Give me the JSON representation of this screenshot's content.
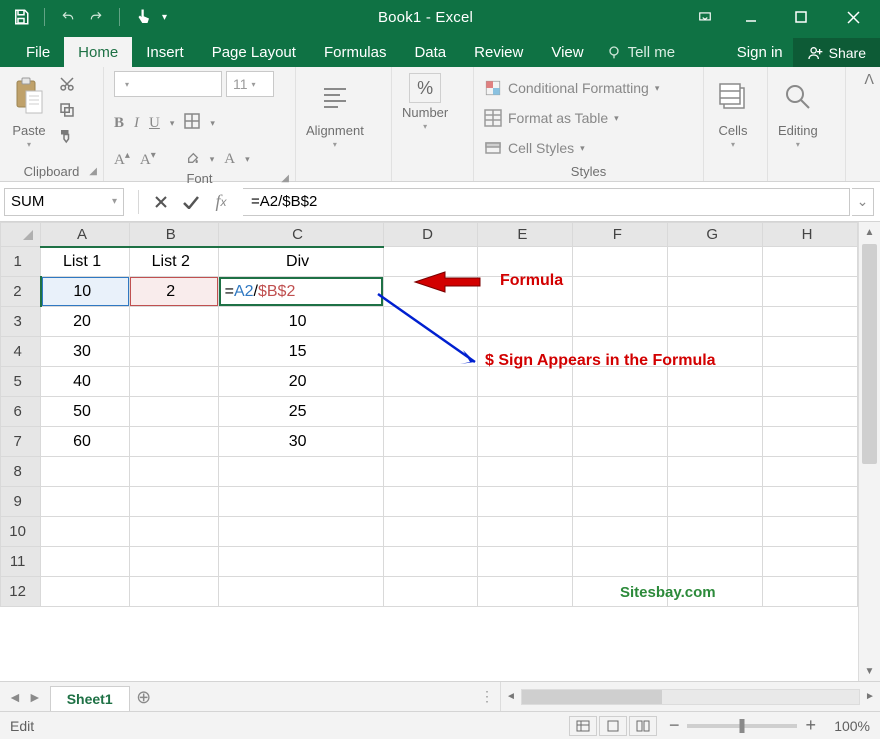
{
  "app": {
    "title": "Book1 - Excel"
  },
  "tabs": {
    "file": "File",
    "home": "Home",
    "insert": "Insert",
    "pageLayout": "Page Layout",
    "formulas": "Formulas",
    "data": "Data",
    "review": "Review",
    "view": "View",
    "tell": "Tell me",
    "signin": "Sign in",
    "share": "Share"
  },
  "ribbon": {
    "clipboard": {
      "paste": "Paste",
      "label": "Clipboard"
    },
    "font": {
      "nameHolder": "",
      "size": "11",
      "bold": "B",
      "italic": "I",
      "underline": "U",
      "label": "Font"
    },
    "alignment": {
      "big": "Alignment"
    },
    "number": {
      "big": "Number",
      "percent": "%"
    },
    "styles": {
      "cond": "Conditional Formatting",
      "table": "Format as Table",
      "cell": "Cell Styles",
      "label": "Styles"
    },
    "cells": {
      "big": "Cells"
    },
    "editing": {
      "big": "Editing"
    }
  },
  "formulaBar": {
    "nameBox": "SUM",
    "formula": "=A2/$B$2"
  },
  "columns": [
    "A",
    "B",
    "C",
    "D",
    "E",
    "F",
    "G",
    "H"
  ],
  "rowNums": [
    1,
    2,
    3,
    4,
    5,
    6,
    7,
    8,
    9,
    10,
    11,
    12
  ],
  "headers": {
    "A": "List 1",
    "B": "List 2",
    "C": "Div"
  },
  "data": {
    "r2": {
      "A": "10",
      "B": "2"
    },
    "r3": {
      "A": "20",
      "C": "10"
    },
    "r4": {
      "A": "30",
      "C": "15"
    },
    "r5": {
      "A": "40",
      "C": "20"
    },
    "r6": {
      "A": "50",
      "C": "25"
    },
    "r7": {
      "A": "60",
      "C": "30"
    }
  },
  "editCell": {
    "eq": "=",
    "ref1": "A2",
    "op": "/",
    "ref2": "$B$2"
  },
  "sheetTabs": {
    "name": "Sheet1"
  },
  "status": {
    "mode": "Edit",
    "zoom": "100%"
  },
  "annotations": {
    "formula": "Formula",
    "dollar": "$ Sign Appears in the Formula",
    "site": "Sitesbay.com"
  }
}
